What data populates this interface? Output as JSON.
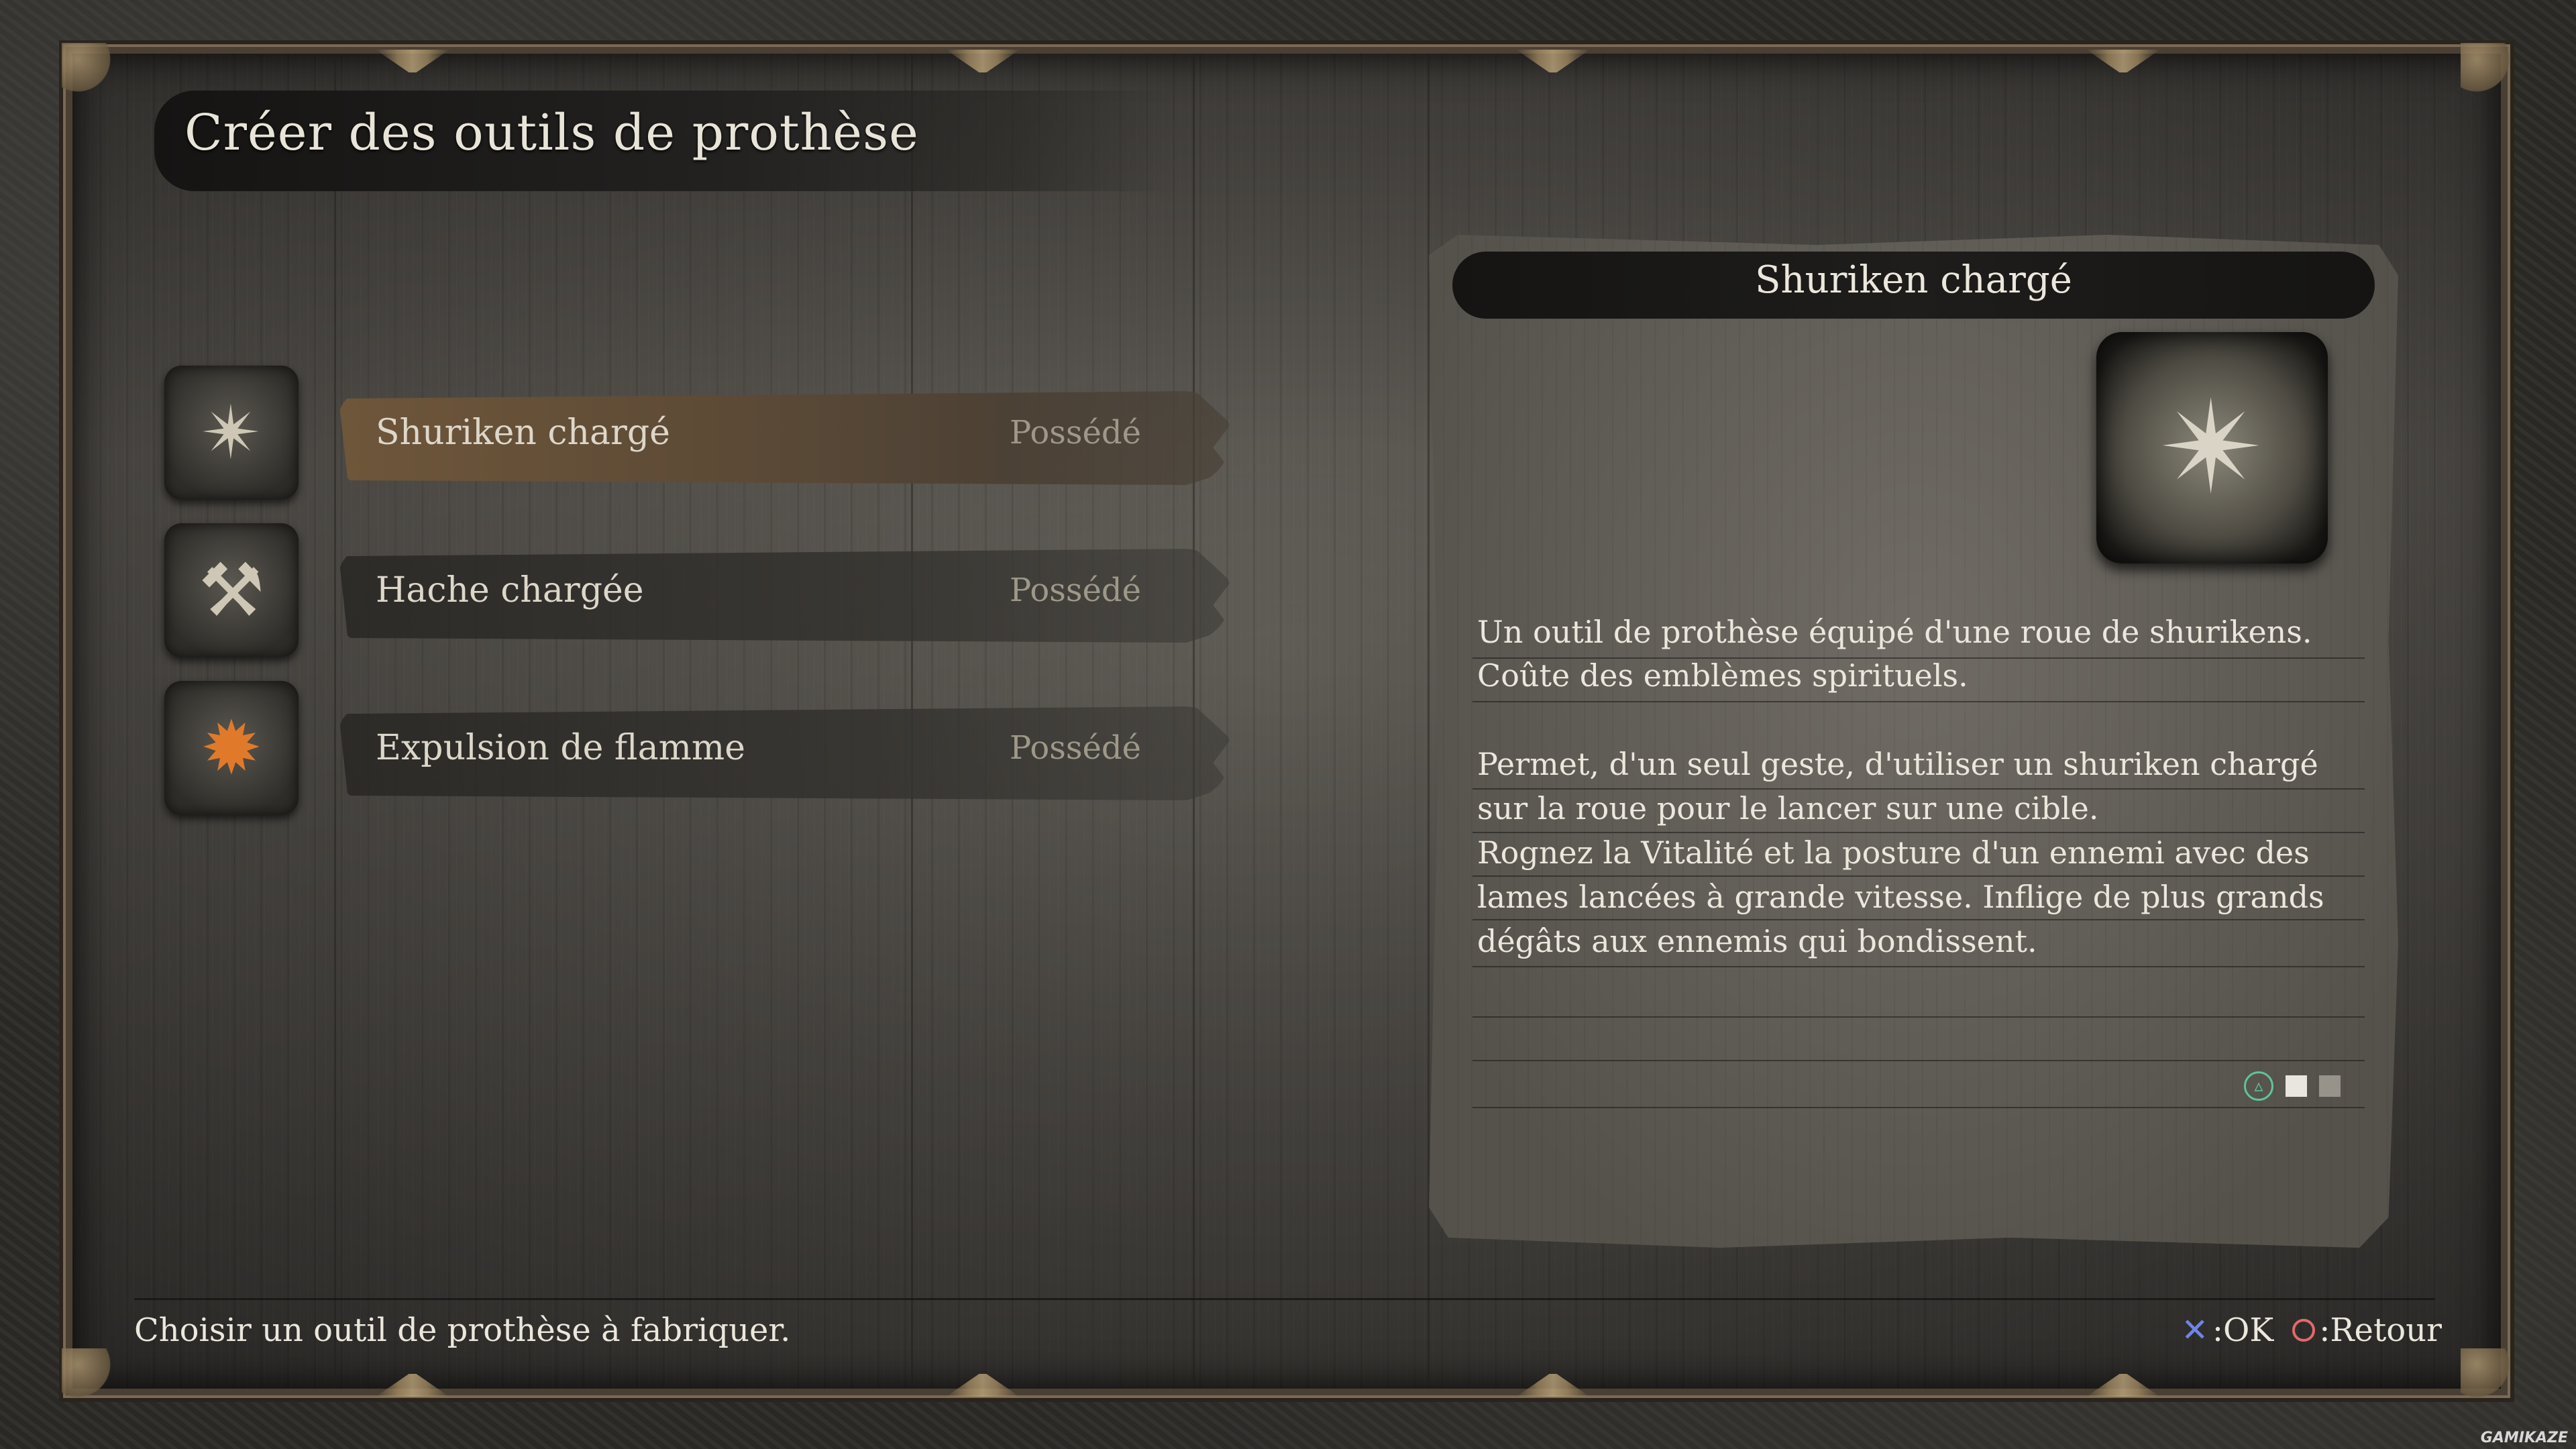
{
  "screen": {
    "title": "Créer des outils de prothèse",
    "hint": "Choisir un outil de prothèse à fabriquer."
  },
  "tools": [
    {
      "name": "Shuriken chargé",
      "status": "Possédé",
      "icon": "shuriken-icon",
      "selected": true
    },
    {
      "name": "Hache chargée",
      "status": "Possédé",
      "icon": "axe-icon",
      "selected": false
    },
    {
      "name": "Expulsion de flamme",
      "status": "Possédé",
      "icon": "flame-icon",
      "selected": false
    }
  ],
  "detail": {
    "title": "Shuriken chargé",
    "image_icon": "shuriken-wheel-icon",
    "lines": [
      "Un outil de prothèse équipé d'une roue de shurikens.",
      "Coûte des emblèmes spirituels.",
      "",
      "Permet, d'un seul geste, d'utiliser un shuriken chargé",
      "sur la roue pour le lancer sur une cible.",
      "Rognez la Vitalité et la posture d'un ennemi avec des",
      "lames lancées à grande vitesse. Inflige de plus grands",
      "dégâts aux ennemis qui bondissent."
    ],
    "page_indicator_icons": [
      "triangle-button-icon",
      "page-square-active",
      "page-square-inactive"
    ]
  },
  "controls": {
    "ok_label": ":OK",
    "back_label": ":Retour",
    "ok_icon": "cross-button-icon",
    "back_icon": "circle-button-icon"
  },
  "watermark": "GAMIKAZE",
  "colors": {
    "selected_bar": "#6e563a",
    "cross_button": "#6f85e8",
    "circle_button": "#e06a6e",
    "triangle_button": "#5fc59a"
  }
}
